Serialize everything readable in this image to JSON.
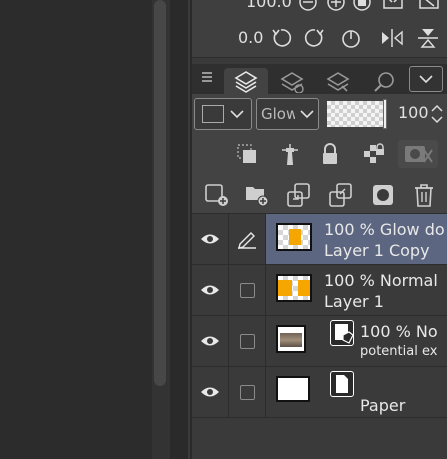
{
  "top": {
    "row1_value": "100.0",
    "row2_value": "0.0"
  },
  "tabs": [
    "layer-tab",
    "layer-property-tab",
    "layer-search-tab",
    "navigator-tab"
  ],
  "properties": {
    "blend_mode": "Glow",
    "opacity": "100"
  },
  "layers": [
    {
      "line1": "100 % Glow do",
      "line2": "Layer 1 Copy",
      "selected": true
    },
    {
      "line1": "100 % Normal",
      "line2": "Layer 1",
      "selected": false
    },
    {
      "line1": "100 % No",
      "line2": "potential ex",
      "selected": false
    },
    {
      "line1": "",
      "line2": "Paper",
      "selected": false
    }
  ]
}
